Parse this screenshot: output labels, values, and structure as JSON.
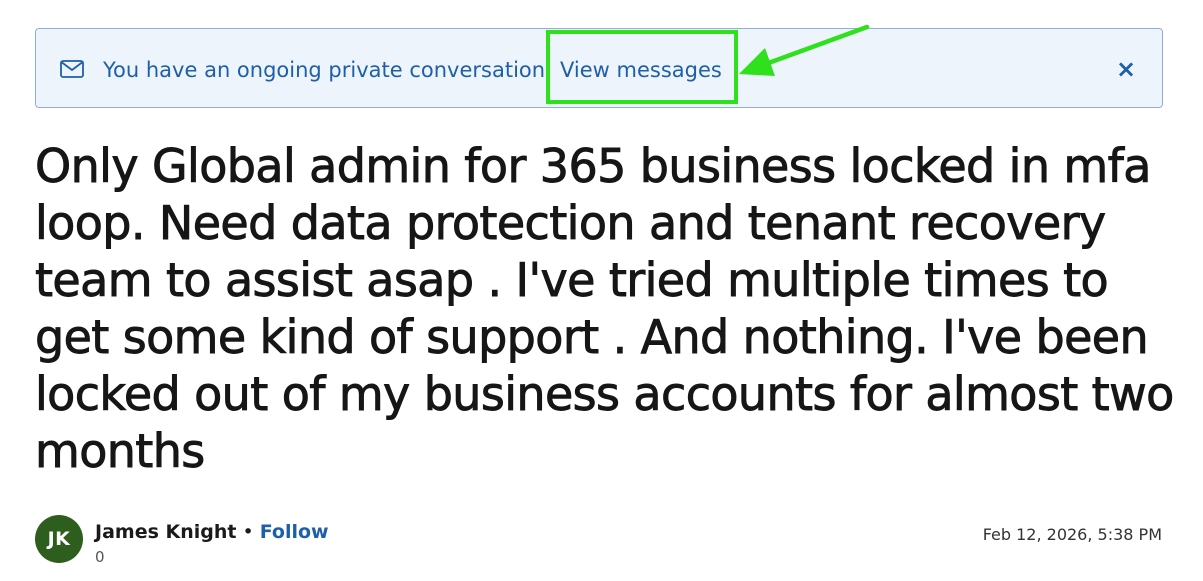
{
  "banner": {
    "icon": "mail-icon",
    "message": "You have an ongoing private conversation.",
    "link_label": "View messages",
    "close_label": "×",
    "text_color": "#1d5fa8",
    "background": "#eef4fb"
  },
  "annotation": {
    "color": "#2fe01c"
  },
  "post": {
    "title": "Only Global admin for 365 business locked in mfa loop. Need data protection and tenant recovery team to assist asap . I've tried multiple times to get some kind of support . And nothing. I've been locked out of my business accounts for almost two months",
    "author": {
      "initials": "JK",
      "name": "James Knight",
      "separator": "•",
      "follow_label": "Follow",
      "count": "0",
      "avatar_color": "#2e5e1e"
    },
    "date": "Feb 12, 2026, 5:38 PM"
  }
}
